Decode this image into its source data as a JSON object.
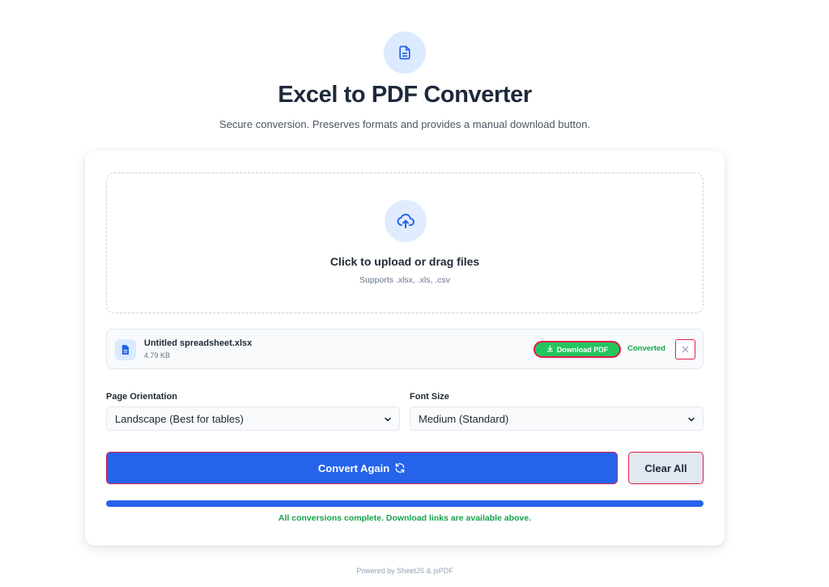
{
  "header": {
    "icon": "document-icon",
    "title": "Excel to PDF Converter",
    "subtitle": "Secure conversion. Preserves formats and provides a manual download button."
  },
  "dropzone": {
    "icon": "cloud-upload-icon",
    "title": "Click to upload or drag files",
    "hint": "Supports .xlsx, .xls, .csv"
  },
  "file": {
    "icon": "file-icon",
    "name": "Untitled spreadsheet.xlsx",
    "size": "4.79 KB",
    "download_label": "Download PDF",
    "status": "Converted"
  },
  "options": {
    "orientation_label": "Page Orientation",
    "orientation_value": "Landscape (Best for tables)",
    "font_size_label": "Font Size",
    "font_size_value": "Medium (Standard)"
  },
  "actions": {
    "convert_label": "Convert Again",
    "clear_label": "Clear All"
  },
  "progress": {
    "percent": 100,
    "message": "All conversions complete. Download links are available above."
  },
  "footer": "Powered by SheetJS & jsPDF",
  "colors": {
    "accent": "#2563eb",
    "success": "#22c55e",
    "success_text": "#16a34a",
    "danger_outline": "#e11d48"
  }
}
